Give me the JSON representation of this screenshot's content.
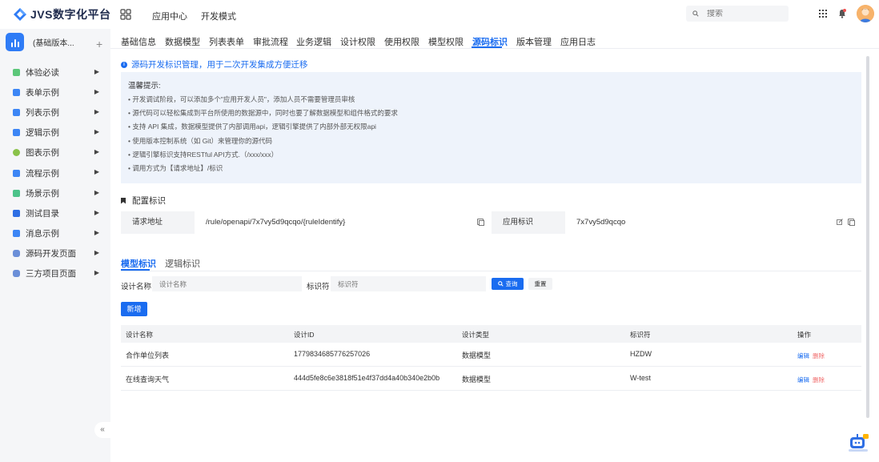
{
  "brand": {
    "name": "JVS数字化平台"
  },
  "top_nav": {
    "items": [
      "应用中心",
      "开发模式"
    ]
  },
  "search": {
    "placeholder": "搜索"
  },
  "app": {
    "name": "(基础版本..."
  },
  "sidebar": {
    "items": [
      {
        "label": "体验必读",
        "color": "#5cc77a"
      },
      {
        "label": "表单示例",
        "color": "#3d86f5"
      },
      {
        "label": "列表示例",
        "color": "#3d86f5"
      },
      {
        "label": "逻辑示例",
        "color": "#3d86f5"
      },
      {
        "label": "图表示例",
        "color": "#8ac24a"
      },
      {
        "label": "流程示例",
        "color": "#3d86f5"
      },
      {
        "label": "场景示例",
        "color": "#4cc38a"
      },
      {
        "label": "测试目录",
        "color": "#2f6fe4"
      },
      {
        "label": "消息示例",
        "color": "#3d86f5"
      },
      {
        "label": "源码开发页面",
        "color": "#6b8fd8"
      },
      {
        "label": "三方项目页面",
        "color": "#6b8fd8"
      }
    ],
    "collapse": "«"
  },
  "tabs": [
    "基础信息",
    "数据模型",
    "列表表单",
    "审批流程",
    "业务逻辑",
    "设计权限",
    "使用权限",
    "模型权限",
    "源码标识",
    "版本管理",
    "应用日志"
  ],
  "active_tab": "源码标识",
  "notice": {
    "title": "源码开发标识管理，用于二次开发集成方便迁移",
    "tip_head": "温馨提示:",
    "tips": [
      "• 开发调试阶段，可以添加多个\"应用开发人员\"，添加人员不需要管理员审核",
      "• 源代码可以轻松集成到平台所使用的数据源中，同时也要了解数据模型和组件格式的要求",
      "• 支持 API 集成，数据模型提供了内部调用api，逻辑引擎提供了内部外部无权限api",
      "• 使用版本控制系统（如 Git）来管理你的源代码",
      "• 逻辑引擎标识支持RESTful API方式.（/xxx/xxx）",
      "• 调用方式为【请求地址】/标识"
    ]
  },
  "config": {
    "title": "配置标识",
    "request_label": "请求地址",
    "request_value": "/rule/openapi/7x7vy5d9qcqo/{ruleIdentify}",
    "app_label": "应用标识",
    "app_value": "7x7vy5d9qcqo"
  },
  "subtabs": [
    "模型标识",
    "逻辑标识"
  ],
  "filter": {
    "design_label": "设计名称",
    "design_placeholder": "设计名称",
    "ident_label": "标识符",
    "ident_placeholder": "标识符",
    "query": "查询",
    "reset": "重置"
  },
  "add_button": "新增",
  "table": {
    "columns": [
      "设计名称",
      "设计ID",
      "设计类型",
      "标识符",
      "操作"
    ],
    "rows": [
      {
        "name": "合作单位列表",
        "id": "1779834685776257026",
        "type": "数据模型",
        "ident": "HZDW",
        "edit": "编辑",
        "del": "删除"
      },
      {
        "name": "在线查询天气",
        "id": "444d5fe8c6e3818f51e4f37dd4a40b340e2b0b",
        "type": "数据模型",
        "ident": "W-test",
        "edit": "编辑",
        "del": "删除"
      }
    ]
  }
}
